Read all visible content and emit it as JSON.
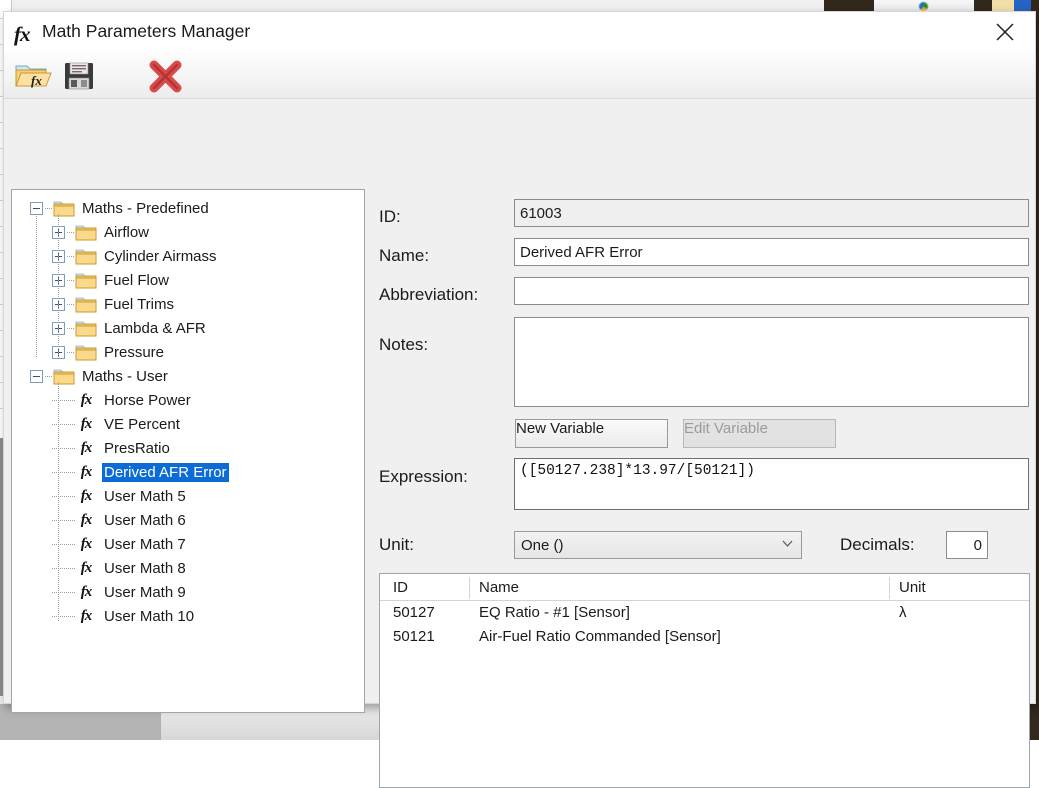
{
  "window": {
    "title": "Math Parameters Manager",
    "title_icon": "fx-icon",
    "close_label": "×"
  },
  "toolbar": {
    "items": [
      {
        "name": "open-math-file-button",
        "icon": "folder-open-fx-icon"
      },
      {
        "name": "save-math-file-button",
        "icon": "floppy-save-icon"
      },
      {
        "name": "delete-math-parameter-button",
        "icon": "red-x-delete-icon"
      }
    ]
  },
  "tree": {
    "nodes": [
      {
        "label": "Maths - Predefined",
        "depth": 0,
        "icon": "folder-icon",
        "toggle": "minus",
        "selected": false
      },
      {
        "label": "Airflow",
        "depth": 1,
        "icon": "folder-icon",
        "toggle": "plus",
        "selected": false
      },
      {
        "label": "Cylinder Airmass",
        "depth": 1,
        "icon": "folder-icon",
        "toggle": "plus",
        "selected": false
      },
      {
        "label": "Fuel Flow",
        "depth": 1,
        "icon": "folder-icon",
        "toggle": "plus",
        "selected": false
      },
      {
        "label": "Fuel Trims",
        "depth": 1,
        "icon": "folder-icon",
        "toggle": "plus",
        "selected": false
      },
      {
        "label": "Lambda & AFR",
        "depth": 1,
        "icon": "folder-icon",
        "toggle": "plus",
        "selected": false
      },
      {
        "label": "Pressure",
        "depth": 1,
        "icon": "folder-icon",
        "toggle": "plus",
        "selected": false
      },
      {
        "label": "Maths - User",
        "depth": 0,
        "icon": "folder-icon",
        "toggle": "minus",
        "selected": false
      },
      {
        "label": "Horse Power",
        "depth": 1,
        "icon": "fx-icon",
        "toggle": "none",
        "selected": false
      },
      {
        "label": "VE Percent",
        "depth": 1,
        "icon": "fx-icon",
        "toggle": "none",
        "selected": false
      },
      {
        "label": "PresRatio",
        "depth": 1,
        "icon": "fx-icon",
        "toggle": "none",
        "selected": false
      },
      {
        "label": "Derived AFR Error",
        "depth": 1,
        "icon": "fx-icon",
        "toggle": "none",
        "selected": true
      },
      {
        "label": "User Math 5",
        "depth": 1,
        "icon": "fx-icon",
        "toggle": "none",
        "selected": false
      },
      {
        "label": "User Math 6",
        "depth": 1,
        "icon": "fx-icon",
        "toggle": "none",
        "selected": false
      },
      {
        "label": "User Math 7",
        "depth": 1,
        "icon": "fx-icon",
        "toggle": "none",
        "selected": false
      },
      {
        "label": "User Math 8",
        "depth": 1,
        "icon": "fx-icon",
        "toggle": "none",
        "selected": false
      },
      {
        "label": "User Math 9",
        "depth": 1,
        "icon": "fx-icon",
        "toggle": "none",
        "selected": false
      },
      {
        "label": "User Math 10",
        "depth": 1,
        "icon": "fx-icon",
        "toggle": "none",
        "selected": false
      }
    ]
  },
  "form": {
    "id_label": "ID:",
    "id_value": "61003",
    "name_label": "Name:",
    "name_value": "Derived AFR Error",
    "abbreviation_label": "Abbreviation:",
    "abbreviation_value": "",
    "abbreviation_placeholder": "",
    "notes_label": "Notes:",
    "notes_value": "",
    "notes_placeholder": "",
    "new_variable_label": "New Variable",
    "edit_variable_label": "Edit Variable",
    "edit_variable_enabled": false,
    "expression_label": "Expression:",
    "expression_value": "([50127.238]*13.97/[50121])",
    "unit_label": "Unit:",
    "unit_value": "One ()",
    "decimals_label": "Decimals:",
    "decimals_value": "0"
  },
  "variables_grid": {
    "columns": [
      "ID",
      "Name",
      "Unit"
    ],
    "rows": [
      {
        "id": "50127",
        "name": "EQ Ratio - #1 [Sensor]",
        "unit": "λ"
      },
      {
        "id": "50121",
        "name": "Air-Fuel Ratio Commanded [Sensor]",
        "unit": ""
      }
    ]
  },
  "background": {
    "bottom_chevron": "❯"
  },
  "colors": {
    "selection": "#0a6cd4",
    "dialog_bg": "#f0f0f0",
    "folder": "#f5c761",
    "delete_x": "#cf3a3a",
    "taskbar_dark": "#33281c"
  }
}
